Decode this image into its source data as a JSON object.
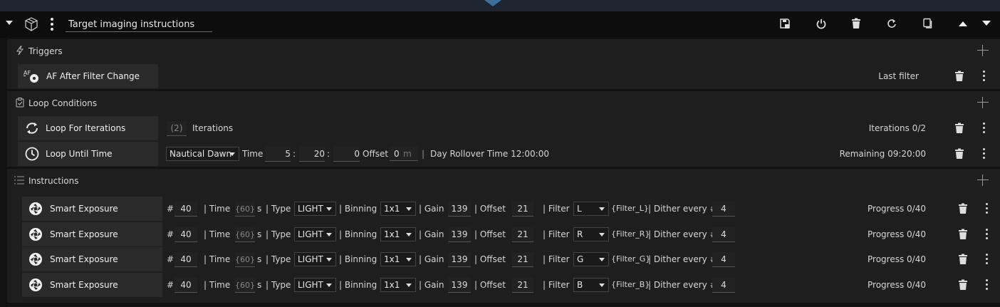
{
  "header": {
    "title": "Target imaging instructions"
  },
  "triggers": {
    "label": "Triggers",
    "items": [
      {
        "name": "AF After Filter Change",
        "badge": "AF",
        "status": "Last filter"
      }
    ]
  },
  "loop_conditions": {
    "label": "Loop Conditions",
    "iterations_item": {
      "name": "Loop For Iterations",
      "count": "(2)",
      "count_label": "Iterations",
      "status": "Iterations 0/2"
    },
    "time_item": {
      "name": "Loop Until Time",
      "source": "Nautical Dawn",
      "time_label": "Time",
      "hours": "5",
      "minutes": "20",
      "seconds": "0",
      "offset_label": "Offset",
      "offset_value": "0",
      "offset_unit": "m",
      "rollover": "Day Rollover Time 12:00:00",
      "status": "Remaining 09:20:00"
    }
  },
  "instructions": {
    "label": "Instructions",
    "labels": {
      "hash": "#",
      "time": "| Time",
      "seconds": "s",
      "type": "| Type",
      "binning": "| Binning",
      "gain": "| Gain",
      "offset": "| Offset",
      "filter": "| Filter",
      "dither": "| Dither every #"
    },
    "items": [
      {
        "name": "Smart Exposure",
        "count": "40",
        "time": "{60}",
        "type": "LIGHT",
        "binning": "1x1",
        "gain": "139",
        "offset": "21",
        "filter": "L",
        "filter_token": "{Filter_L}",
        "dither": "4",
        "status": "Progress 0/40"
      },
      {
        "name": "Smart Exposure",
        "count": "40",
        "time": "{60}",
        "type": "LIGHT",
        "binning": "1x1",
        "gain": "139",
        "offset": "21",
        "filter": "R",
        "filter_token": "{Filter_R}",
        "dither": "4",
        "status": "Progress 0/40"
      },
      {
        "name": "Smart Exposure",
        "count": "40",
        "time": "{60}",
        "type": "LIGHT",
        "binning": "1x1",
        "gain": "139",
        "offset": "21",
        "filter": "G",
        "filter_token": "{Filter_G}",
        "dither": "4",
        "status": "Progress 0/40"
      },
      {
        "name": "Smart Exposure",
        "count": "40",
        "time": "{60}",
        "type": "LIGHT",
        "binning": "1x1",
        "gain": "139",
        "offset": "21",
        "filter": "B",
        "filter_token": "{Filter_B}",
        "dither": "4",
        "status": "Progress 0/40"
      }
    ]
  },
  "icons": {
    "collapse": "chevron-down-icon",
    "container": "cube-icon",
    "save": "save-icon",
    "power": "power-icon",
    "delete": "trash-icon",
    "reset": "redo-icon",
    "duplicate": "copy-icon",
    "move_up": "arrow-up-icon",
    "move_down": "arrow-down-icon",
    "trigger": "lightning-icon",
    "loop_condition": "clipboard-check-icon",
    "instructions": "list-icon",
    "loop": "loop-icon",
    "clock": "clock-icon",
    "camera": "aperture-icon"
  },
  "colors": {
    "background": "#121212",
    "panel": "#1e1e1e",
    "item": "#2a2a2a",
    "header": "#0d0d0d",
    "accent": "#3d6f99"
  }
}
